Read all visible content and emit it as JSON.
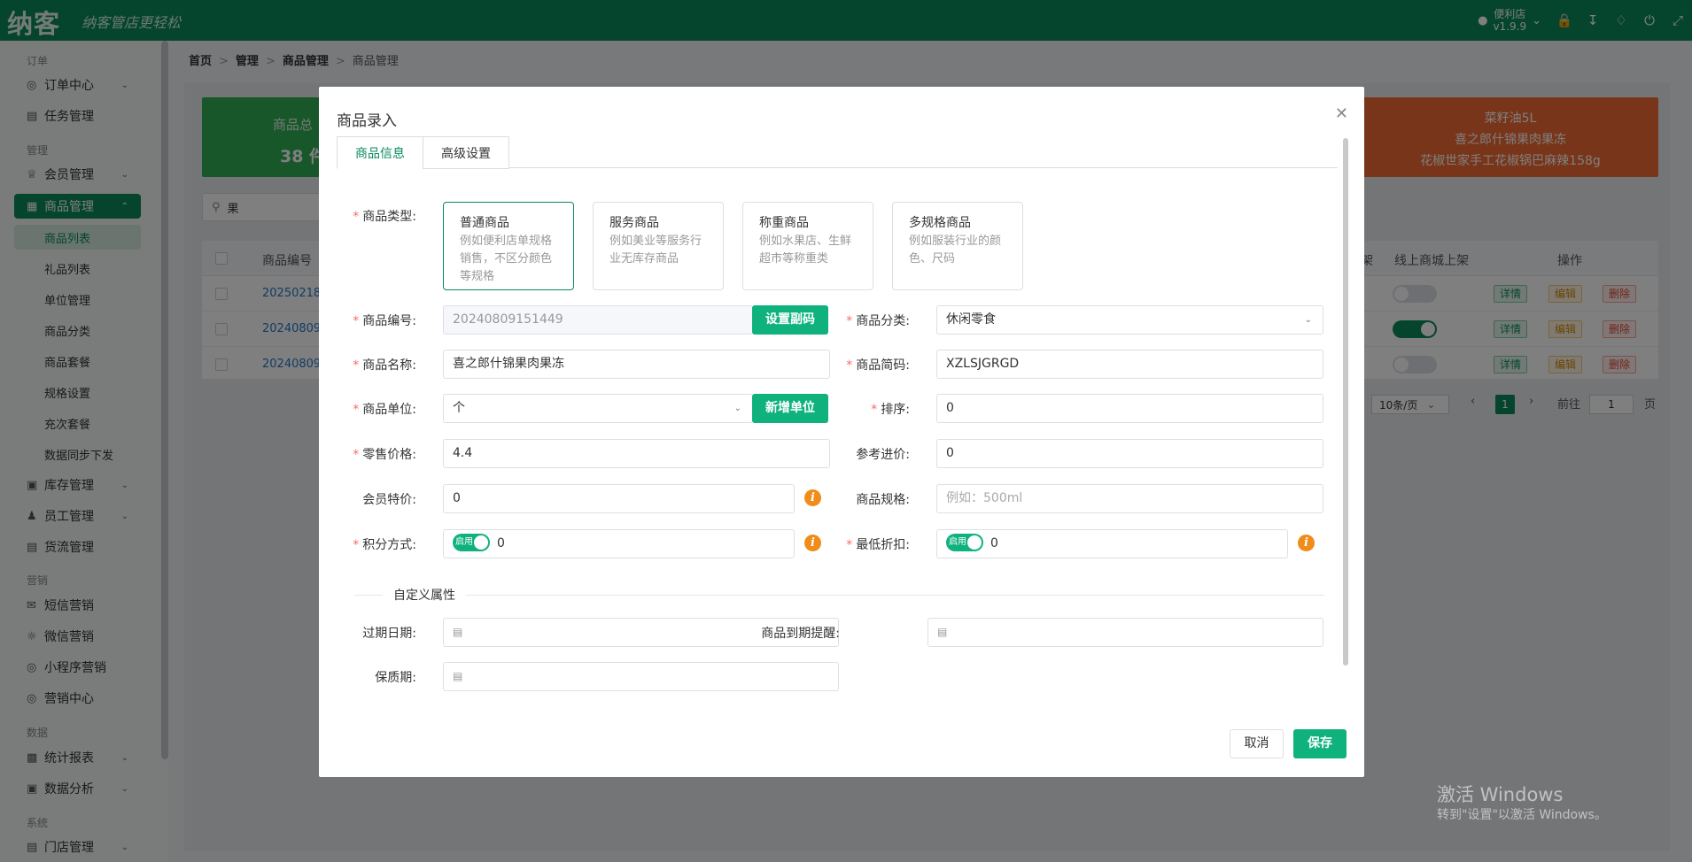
{
  "app": {
    "logo": "纳客",
    "slogan": "纳客管店更轻松",
    "user": "便利店",
    "version": "v1.9.9"
  },
  "sidebar": {
    "groups": [
      "订单",
      "管理",
      "营销",
      "数据",
      "系统"
    ],
    "items": {
      "orders": "订单中心",
      "tasks": "任务管理",
      "members": "会员管理",
      "goods": "商品管理",
      "stock": "库存管理",
      "staff": "员工管理",
      "logistics": "货流管理",
      "sms": "短信营销",
      "wechat": "微信营销",
      "miniapp": "小程序营销",
      "center": "营销中心",
      "reports": "统计报表",
      "analysis": "数据分析",
      "store": "门店管理"
    },
    "sub": [
      "商品列表",
      "礼品列表",
      "单位管理",
      "商品分类",
      "商品套餐",
      "规格设置",
      "充次套餐",
      "数据同步下发"
    ]
  },
  "breadcrumb": [
    "首页",
    "管理",
    "商品管理",
    "商品管理"
  ],
  "stats": {
    "total_label": "商品总",
    "total_value": "38 件",
    "top_items": [
      "菜籽油5L",
      "喜之郎什锦果肉果冻",
      "花椒世家手工花椒锅巴麻辣158g"
    ]
  },
  "search": {
    "value": "果"
  },
  "table": {
    "headers": {
      "code": "商品编号",
      "shelf": "架",
      "online": "线上商城上架",
      "ops": "操作"
    },
    "rows": [
      {
        "code": "20250218"
      },
      {
        "code": "20240809"
      },
      {
        "code": "20240809"
      }
    ],
    "actions": {
      "detail": "详情",
      "edit": "编辑",
      "del": "删除"
    }
  },
  "pager": {
    "size": "10条/页",
    "page": "1",
    "goto": "前往",
    "goto_val": "1",
    "unit": "页"
  },
  "watermark": {
    "l1": "激活 Windows",
    "l2": "转到\"设置\"以激活 Windows。"
  },
  "dialog": {
    "title": "商品录入",
    "tabs": [
      "商品信息",
      "高级设置"
    ],
    "labels": {
      "type": "商品类型:",
      "code": "商品编号:",
      "category": "商品分类:",
      "name": "商品名称:",
      "abbr": "商品简码:",
      "unit": "商品单位:",
      "sort": "排序:",
      "retail": "零售价格:",
      "ref_price": "参考进价:",
      "member_price": "会员特价:",
      "spec": "商品规格:",
      "points": "积分方式:",
      "min_discount": "最低折扣:",
      "expire": "过期日期:",
      "remind": "商品到期提醒:",
      "shelf_life": "保质期:"
    },
    "types": [
      {
        "name": "普通商品",
        "desc": "例如便利店单规格销售，不区分颜色等规格"
      },
      {
        "name": "服务商品",
        "desc": "例如美业等服务行业无库存商品"
      },
      {
        "name": "称重商品",
        "desc": "例如水果店、生鲜超市等称重类"
      },
      {
        "name": "多规格商品",
        "desc": "例如服装行业的颜色、尺码"
      }
    ],
    "values": {
      "code": "20240809151449",
      "category": "休闲零食",
      "name": "喜之郎什锦果肉果冻",
      "abbr": "XZLSJGRGD",
      "unit": "个",
      "sort": "0",
      "retail": "4.4",
      "ref_price": "0",
      "member_price": "0",
      "spec_placeholder": "例如：500ml",
      "points": "0",
      "min_discount": "0"
    },
    "switch_label": "启用",
    "buttons": {
      "set_code": "设置副码",
      "add_unit": "新增单位",
      "cancel": "取消",
      "save": "保存"
    },
    "custom_section": "自定义属性"
  }
}
